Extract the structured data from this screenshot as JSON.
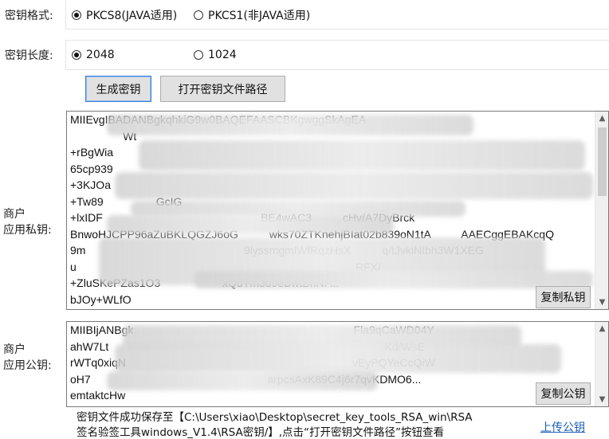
{
  "key_format": {
    "label": "密钥格式:",
    "options": [
      {
        "label": "PKCS8(JAVA适用)",
        "selected": true
      },
      {
        "label": "PKCS1(非JAVA适用)",
        "selected": false
      }
    ]
  },
  "key_length": {
    "label": "密钥长度:",
    "options": [
      {
        "label": "2048",
        "selected": true
      },
      {
        "label": "1024",
        "selected": false
      }
    ]
  },
  "buttons": {
    "generate": "生成密钥",
    "open_path": "打开密钥文件路径"
  },
  "private_key": {
    "label_line1": "商户",
    "label_line2": "应用私钥:",
    "lines": [
      "MIIEvgIBADANBgkqhkiG9w0BAQEFAASCBKgwggSkAgEA",
      "                 Wt",
      "+rBgWia",
      "65cp939",
      "+3KJOa",
      "+Tw89                 GcIG",
      "+lxIDF                                                   BE4wAC3          cHv/A7DyBrck",
      "BnwoHJCPP96aZuBKLQGZJ6oG          wks70ZTKnehjBIat02b839oN1tA          AAECggEBAKcqQ",
      "9m                                                   9lyssmgmlWfRqzHsX          q/tJvkiNIbh3W1XEG",
      "u                                                                                          RFX/",
      "+ZluSKePZas1O3                    xQuTm3o9eBwtBhNF...",
      "bJOy+WLfO"
    ],
    "copy_button": "复制私钥"
  },
  "public_key": {
    "label_line1": "商户",
    "label_line2": "应用公钥:",
    "lines": [
      "MIIBIjANBgk                                                                       Fla9qCaWD04Y",
      "ahW7Lt                                                                                         Kd/WsE",
      "rWTq0xiqN                                                                         vEyPQYeCcQiW",
      "oH7                                                         arpcsAxK89C4j6r7qvKDMO6...",
      "emtaktcHw"
    ],
    "copy_button": "复制公钥"
  },
  "status": {
    "line1": "密钥文件成功保存至【C:\\Users\\xiao\\Desktop\\secret_key_tools_RSA_win\\RSA",
    "line2": "签名验签工具windows_V1.4\\RSA密钥/】,点击“打开密钥文件路径”按钮查看"
  },
  "upload_link": "上传公钥",
  "scroll_icons": {
    "up": "chevron-up-icon",
    "down": "chevron-down-icon"
  }
}
